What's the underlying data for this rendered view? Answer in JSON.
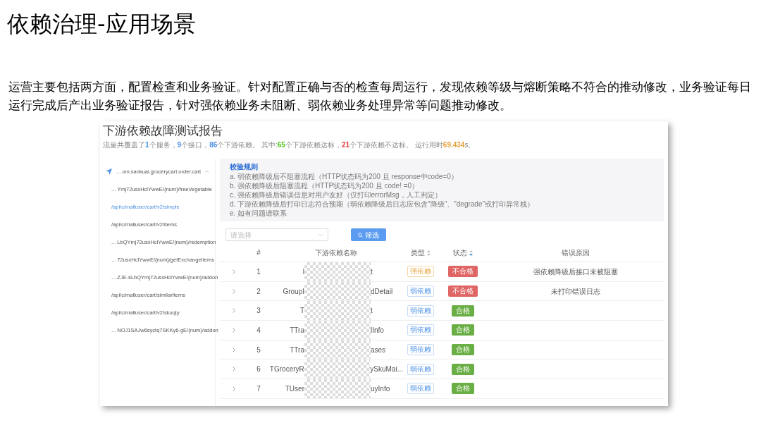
{
  "slide": {
    "title": "依赖治理-应用场景",
    "paragraph": "运营主要包括两方面，配置检查和业务验证。针对配置正确与否的检查每周运行，发现依赖等级与熔断策略不符合的推动修改，业务验证每日运行完成后产出业务验证报告，针对强依赖业务未阻断、弱依赖业务处理异常等问题推动修改。"
  },
  "report": {
    "title": "下游依赖故障测试报告",
    "summary": [
      {
        "kind": "text",
        "text": "流量共覆盖了"
      },
      {
        "kind": "total",
        "text": "1"
      },
      {
        "kind": "text",
        "text": "个服务，"
      },
      {
        "kind": "total",
        "text": "9"
      },
      {
        "kind": "text",
        "text": "个接口，"
      },
      {
        "kind": "total",
        "text": "86"
      },
      {
        "kind": "text",
        "text": "个下游依赖。 其中:"
      },
      {
        "kind": "pass",
        "text": "65"
      },
      {
        "kind": "text",
        "text": "个下游依赖达标，"
      },
      {
        "kind": "fail",
        "text": "21"
      },
      {
        "kind": "text",
        "text": "个下游依赖不达标。 运行用时"
      },
      {
        "kind": "time",
        "text": "69.434"
      },
      {
        "kind": "text",
        "text": "s。"
      }
    ],
    "sidebar": {
      "items": [
        {
          "label": "... om.sankuai.grocerycart.order.cart",
          "expanded": true,
          "selected": false,
          "children": [
            {
              "label": "... Ymj72usxHclYwwE/{num}/freeVegetable",
              "selected": false
            },
            {
              "label": "/api/c/malluser/cart/v2/simple",
              "selected": true
            },
            {
              "label": "/api/c/malluser/cart/v2/items",
              "selected": false
            },
            {
              "label": "... LbQYmj72usxHclYwwE/{num}/redemption",
              "selected": false
            },
            {
              "label": "... 72usxHclYwwE/{num}/getExchangeItems",
              "selected": false
            },
            {
              "label": "... ZJE-kLbQYmj72usxHclYwwE/{num}/addon",
              "selected": false
            },
            {
              "label": "/api/c/malluser/cart/similarItems",
              "selected": false
            },
            {
              "label": "/api/c/malluser/cart/v2/skuqty",
              "selected": false
            },
            {
              "label": "... NOJ1SAJw6syctq7SKKy6-gE/{num}/addon",
              "selected": false
            }
          ]
        }
      ]
    },
    "rules": {
      "title": "校验规则",
      "lines": [
        "a. 弱依赖降级后不阻塞流程（HTTP状态码为200 且 response中code=0）",
        "b. 强依赖降级后阻塞流程（HTTP状态码为200 且 code! =0）",
        "c. 强依赖降级后错误信息对用户友好（仅打印errorMsg，人工判定）",
        "d. 下游依赖降级后打印日志符合预期（弱依赖降级后日志应包含\"降级\"、\"degrade\"或打印异常栈）",
        "e. 如有问题请联系"
      ]
    },
    "filter": {
      "placeholder": "请选择",
      "button": "筛选"
    },
    "table": {
      "columns": [
        "#",
        "下游依赖名称",
        "类型",
        "状态",
        "错误原因"
      ],
      "rows": [
        {
          "index": "1",
          "name_start": "l",
          "name_end": "t",
          "type": {
            "text": "强依赖",
            "kind": "strong"
          },
          "status": {
            "text": "不合格",
            "kind": "fail"
          },
          "reason": "强依赖降级后接口未被阻塞"
        },
        {
          "index": "2",
          "name_start": "GroupI",
          "name_end": "dDetail",
          "type": {
            "text": "弱依赖",
            "kind": "weak"
          },
          "status": {
            "text": "不合格",
            "kind": "fail"
          },
          "reason": "未打印错误日志"
        },
        {
          "index": "3",
          "name_start": "T",
          "name_end": "t",
          "type": {
            "text": "弱依赖",
            "kind": "weak"
          },
          "status": {
            "text": "合格",
            "kind": "pass"
          }
        },
        {
          "index": "4",
          "name_start": "TTra",
          "name_end": "lInfo",
          "type": {
            "text": "弱依赖",
            "kind": "weak"
          },
          "status": {
            "text": "合格",
            "kind": "pass"
          }
        },
        {
          "index": "5",
          "name_start": "TTra",
          "name_end": "ases",
          "type": {
            "text": "弱依赖",
            "kind": "weak"
          },
          "status": {
            "text": "合格",
            "kind": "pass"
          }
        },
        {
          "index": "6",
          "name_start": "TGroceryR",
          "name_end": "ySkuMai...",
          "type": {
            "text": "弱依赖",
            "kind": "weak"
          },
          "status": {
            "text": "合格",
            "kind": "pass"
          }
        },
        {
          "index": "7",
          "name_start": "TUser",
          "name_end": "uyInfo",
          "type": {
            "text": "弱依赖",
            "kind": "weak"
          },
          "status": {
            "text": "合格",
            "kind": "pass"
          }
        }
      ]
    }
  }
}
